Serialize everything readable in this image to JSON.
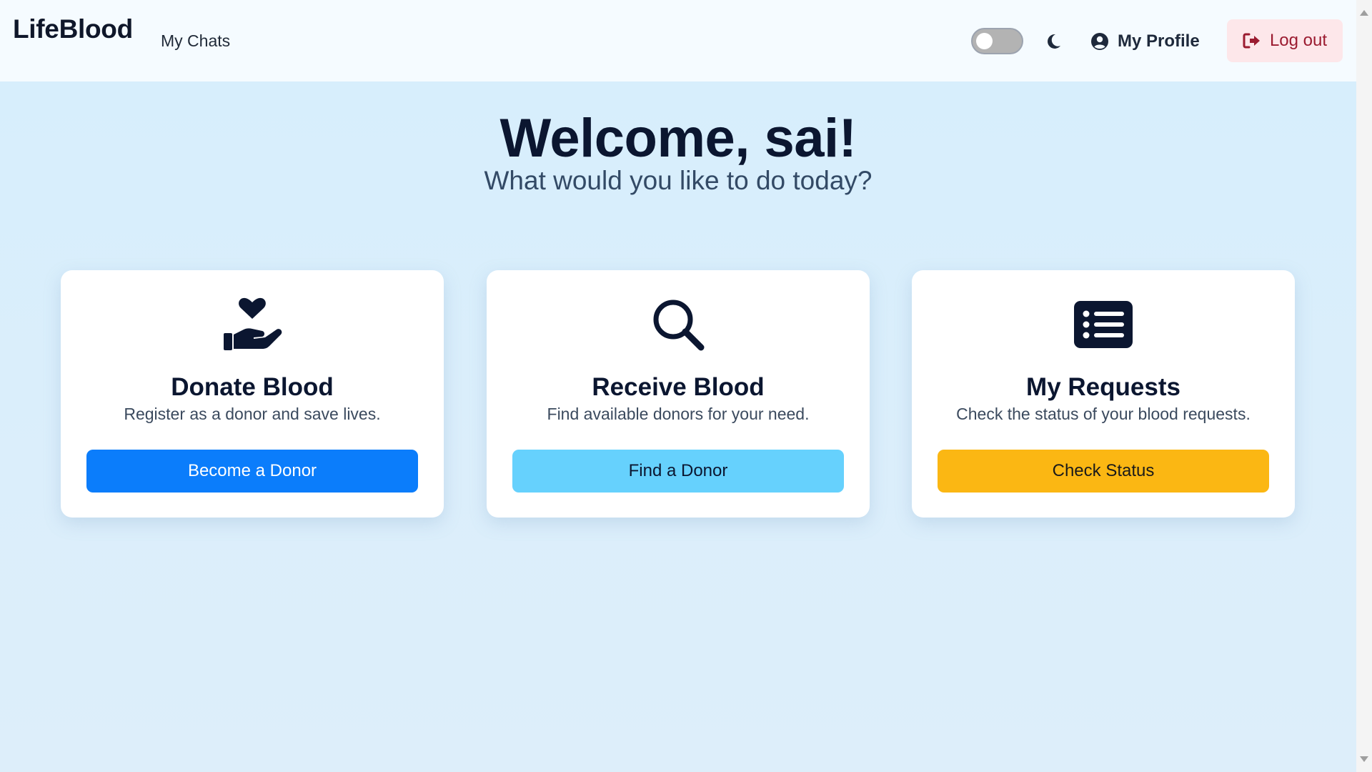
{
  "header": {
    "brand": "LifeBlood",
    "nav_chats": "My Chats",
    "profile_label": "My Profile",
    "logout_label": "Log out",
    "theme_toggle_on": false
  },
  "hero": {
    "title": "Welcome, sai!",
    "subtitle": "What would you like to do today?"
  },
  "cards": [
    {
      "icon": "hand-holding-heart-icon",
      "title": "Donate Blood",
      "description": "Register as a donor and save lives.",
      "button": "Become a Donor",
      "button_color": "#0b7dfb"
    },
    {
      "icon": "search-icon",
      "title": "Receive Blood",
      "description": "Find available donors for your need.",
      "button": "Find a Donor",
      "button_color": "#66d1fd"
    },
    {
      "icon": "list-icon",
      "title": "My Requests",
      "description": "Check the status of your blood requests.",
      "button": "Check Status",
      "button_color": "#fbb713"
    }
  ],
  "colors": {
    "header_bg": "#f5fbff",
    "page_bg": "#d6eefc",
    "logout_bg": "#fde7ea",
    "logout_text": "#9b1b30",
    "text_dark": "#0b1630"
  }
}
